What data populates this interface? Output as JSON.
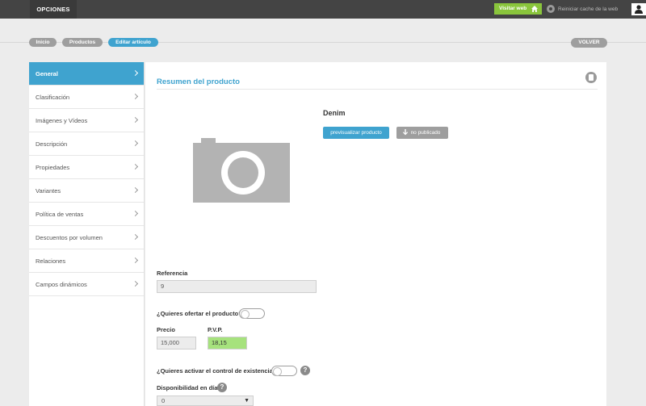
{
  "topbar": {
    "menu_label": "OPCIONES",
    "visit_label": "Visitar web",
    "reset_cache_label": "Reiniciar cache de la web"
  },
  "breadcrumb": {
    "items": [
      "Inicio",
      "Productos",
      "Editar artículo"
    ],
    "back_label": "VOLVER"
  },
  "sidebar": {
    "items": [
      {
        "label": "General"
      },
      {
        "label": "Clasificación"
      },
      {
        "label": "Imágenes y Vídeos"
      },
      {
        "label": "Descripción"
      },
      {
        "label": "Propiedades"
      },
      {
        "label": "Variantes"
      },
      {
        "label": "Política de ventas"
      },
      {
        "label": "Descuentos por volumen"
      },
      {
        "label": "Relaciones"
      },
      {
        "label": "Campos dinámicos"
      }
    ]
  },
  "summary": {
    "title": "Resumen del producto",
    "product_name": "Denim",
    "preview_label": "previsualizar producto",
    "unpublished_label": "no publicado"
  },
  "form": {
    "reference_label": "Referencia",
    "reference_value": "9",
    "offer_question": "¿Quieres ofertar el producto?",
    "price_label": "Precio",
    "price_value": "15,000",
    "pvp_label": "P.V.P.",
    "pvp_value": "18,15",
    "stock_question": "¿Quieres activar el control de existencias?",
    "availability_label": "Disponibilidad en días",
    "availability_value": "0",
    "help_symbol": "?"
  },
  "colors": {
    "accent": "#3fa3cf",
    "visit_green": "#8ac53c",
    "pvp_green": "#a6e27d",
    "topbar": "#444444"
  }
}
